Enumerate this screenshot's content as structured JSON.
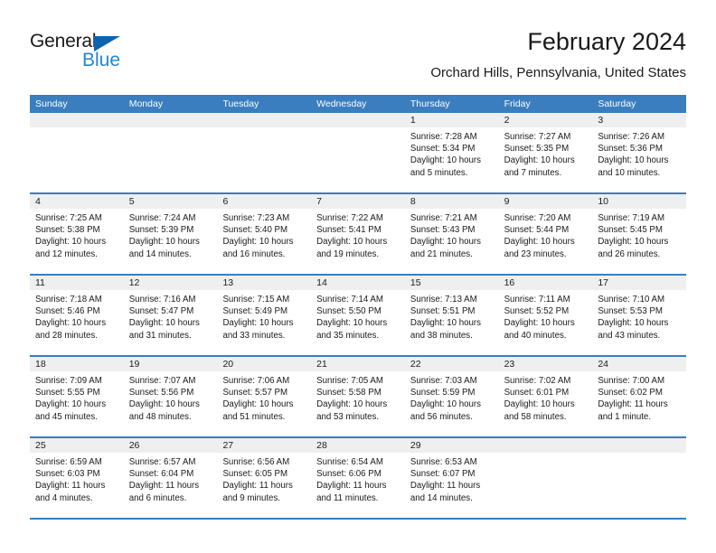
{
  "brand": {
    "name_part1": "General",
    "name_part2": "Blue"
  },
  "header": {
    "title": "February 2024",
    "subtitle": "Orchard Hills, Pennsylvania, United States"
  },
  "colors": {
    "header_blue": "#3a7ebf",
    "logo_blue": "#2585d3",
    "flag_blue": "#0c64b0",
    "day_band": "#efefef"
  },
  "weekdays": [
    "Sunday",
    "Monday",
    "Tuesday",
    "Wednesday",
    "Thursday",
    "Friday",
    "Saturday"
  ],
  "weeks": [
    [
      {
        "day": "",
        "sunrise": "",
        "sunset": "",
        "daylight": ""
      },
      {
        "day": "",
        "sunrise": "",
        "sunset": "",
        "daylight": ""
      },
      {
        "day": "",
        "sunrise": "",
        "sunset": "",
        "daylight": ""
      },
      {
        "day": "",
        "sunrise": "",
        "sunset": "",
        "daylight": ""
      },
      {
        "day": "1",
        "sunrise": "Sunrise: 7:28 AM",
        "sunset": "Sunset: 5:34 PM",
        "daylight": "Daylight: 10 hours and 5 minutes."
      },
      {
        "day": "2",
        "sunrise": "Sunrise: 7:27 AM",
        "sunset": "Sunset: 5:35 PM",
        "daylight": "Daylight: 10 hours and 7 minutes."
      },
      {
        "day": "3",
        "sunrise": "Sunrise: 7:26 AM",
        "sunset": "Sunset: 5:36 PM",
        "daylight": "Daylight: 10 hours and 10 minutes."
      }
    ],
    [
      {
        "day": "4",
        "sunrise": "Sunrise: 7:25 AM",
        "sunset": "Sunset: 5:38 PM",
        "daylight": "Daylight: 10 hours and 12 minutes."
      },
      {
        "day": "5",
        "sunrise": "Sunrise: 7:24 AM",
        "sunset": "Sunset: 5:39 PM",
        "daylight": "Daylight: 10 hours and 14 minutes."
      },
      {
        "day": "6",
        "sunrise": "Sunrise: 7:23 AM",
        "sunset": "Sunset: 5:40 PM",
        "daylight": "Daylight: 10 hours and 16 minutes."
      },
      {
        "day": "7",
        "sunrise": "Sunrise: 7:22 AM",
        "sunset": "Sunset: 5:41 PM",
        "daylight": "Daylight: 10 hours and 19 minutes."
      },
      {
        "day": "8",
        "sunrise": "Sunrise: 7:21 AM",
        "sunset": "Sunset: 5:43 PM",
        "daylight": "Daylight: 10 hours and 21 minutes."
      },
      {
        "day": "9",
        "sunrise": "Sunrise: 7:20 AM",
        "sunset": "Sunset: 5:44 PM",
        "daylight": "Daylight: 10 hours and 23 minutes."
      },
      {
        "day": "10",
        "sunrise": "Sunrise: 7:19 AM",
        "sunset": "Sunset: 5:45 PM",
        "daylight": "Daylight: 10 hours and 26 minutes."
      }
    ],
    [
      {
        "day": "11",
        "sunrise": "Sunrise: 7:18 AM",
        "sunset": "Sunset: 5:46 PM",
        "daylight": "Daylight: 10 hours and 28 minutes."
      },
      {
        "day": "12",
        "sunrise": "Sunrise: 7:16 AM",
        "sunset": "Sunset: 5:47 PM",
        "daylight": "Daylight: 10 hours and 31 minutes."
      },
      {
        "day": "13",
        "sunrise": "Sunrise: 7:15 AM",
        "sunset": "Sunset: 5:49 PM",
        "daylight": "Daylight: 10 hours and 33 minutes."
      },
      {
        "day": "14",
        "sunrise": "Sunrise: 7:14 AM",
        "sunset": "Sunset: 5:50 PM",
        "daylight": "Daylight: 10 hours and 35 minutes."
      },
      {
        "day": "15",
        "sunrise": "Sunrise: 7:13 AM",
        "sunset": "Sunset: 5:51 PM",
        "daylight": "Daylight: 10 hours and 38 minutes."
      },
      {
        "day": "16",
        "sunrise": "Sunrise: 7:11 AM",
        "sunset": "Sunset: 5:52 PM",
        "daylight": "Daylight: 10 hours and 40 minutes."
      },
      {
        "day": "17",
        "sunrise": "Sunrise: 7:10 AM",
        "sunset": "Sunset: 5:53 PM",
        "daylight": "Daylight: 10 hours and 43 minutes."
      }
    ],
    [
      {
        "day": "18",
        "sunrise": "Sunrise: 7:09 AM",
        "sunset": "Sunset: 5:55 PM",
        "daylight": "Daylight: 10 hours and 45 minutes."
      },
      {
        "day": "19",
        "sunrise": "Sunrise: 7:07 AM",
        "sunset": "Sunset: 5:56 PM",
        "daylight": "Daylight: 10 hours and 48 minutes."
      },
      {
        "day": "20",
        "sunrise": "Sunrise: 7:06 AM",
        "sunset": "Sunset: 5:57 PM",
        "daylight": "Daylight: 10 hours and 51 minutes."
      },
      {
        "day": "21",
        "sunrise": "Sunrise: 7:05 AM",
        "sunset": "Sunset: 5:58 PM",
        "daylight": "Daylight: 10 hours and 53 minutes."
      },
      {
        "day": "22",
        "sunrise": "Sunrise: 7:03 AM",
        "sunset": "Sunset: 5:59 PM",
        "daylight": "Daylight: 10 hours and 56 minutes."
      },
      {
        "day": "23",
        "sunrise": "Sunrise: 7:02 AM",
        "sunset": "Sunset: 6:01 PM",
        "daylight": "Daylight: 10 hours and 58 minutes."
      },
      {
        "day": "24",
        "sunrise": "Sunrise: 7:00 AM",
        "sunset": "Sunset: 6:02 PM",
        "daylight": "Daylight: 11 hours and 1 minute."
      }
    ],
    [
      {
        "day": "25",
        "sunrise": "Sunrise: 6:59 AM",
        "sunset": "Sunset: 6:03 PM",
        "daylight": "Daylight: 11 hours and 4 minutes."
      },
      {
        "day": "26",
        "sunrise": "Sunrise: 6:57 AM",
        "sunset": "Sunset: 6:04 PM",
        "daylight": "Daylight: 11 hours and 6 minutes."
      },
      {
        "day": "27",
        "sunrise": "Sunrise: 6:56 AM",
        "sunset": "Sunset: 6:05 PM",
        "daylight": "Daylight: 11 hours and 9 minutes."
      },
      {
        "day": "28",
        "sunrise": "Sunrise: 6:54 AM",
        "sunset": "Sunset: 6:06 PM",
        "daylight": "Daylight: 11 hours and 11 minutes."
      },
      {
        "day": "29",
        "sunrise": "Sunrise: 6:53 AM",
        "sunset": "Sunset: 6:07 PM",
        "daylight": "Daylight: 11 hours and 14 minutes."
      },
      {
        "day": "",
        "sunrise": "",
        "sunset": "",
        "daylight": ""
      },
      {
        "day": "",
        "sunrise": "",
        "sunset": "",
        "daylight": ""
      }
    ]
  ]
}
